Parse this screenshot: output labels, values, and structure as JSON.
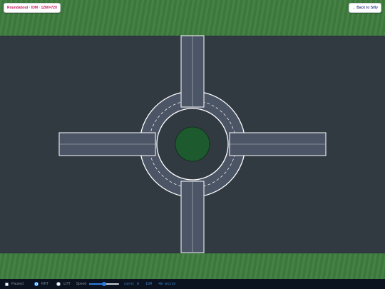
{
  "header": {
    "title": "Roundabout · IDM · 1280×720",
    "back_label": "← Back to Silly"
  },
  "controls": {
    "paused_label": "Paused",
    "paused_checked": false,
    "drive_side_options": [
      "RHT",
      "LHT"
    ],
    "drive_side_selected": "RHT",
    "speed_label": "Speed",
    "speed_value": 0.5,
    "stats": "cars: 0   IDM   48 exits"
  },
  "colors": {
    "grass": "#3f7d3f",
    "asphalt": "#313941",
    "road": "#4c5565",
    "road_edge": "#ffffff",
    "island": "#1d5b2f",
    "title_text": "#c2185b",
    "accent": "#2d7be0"
  }
}
